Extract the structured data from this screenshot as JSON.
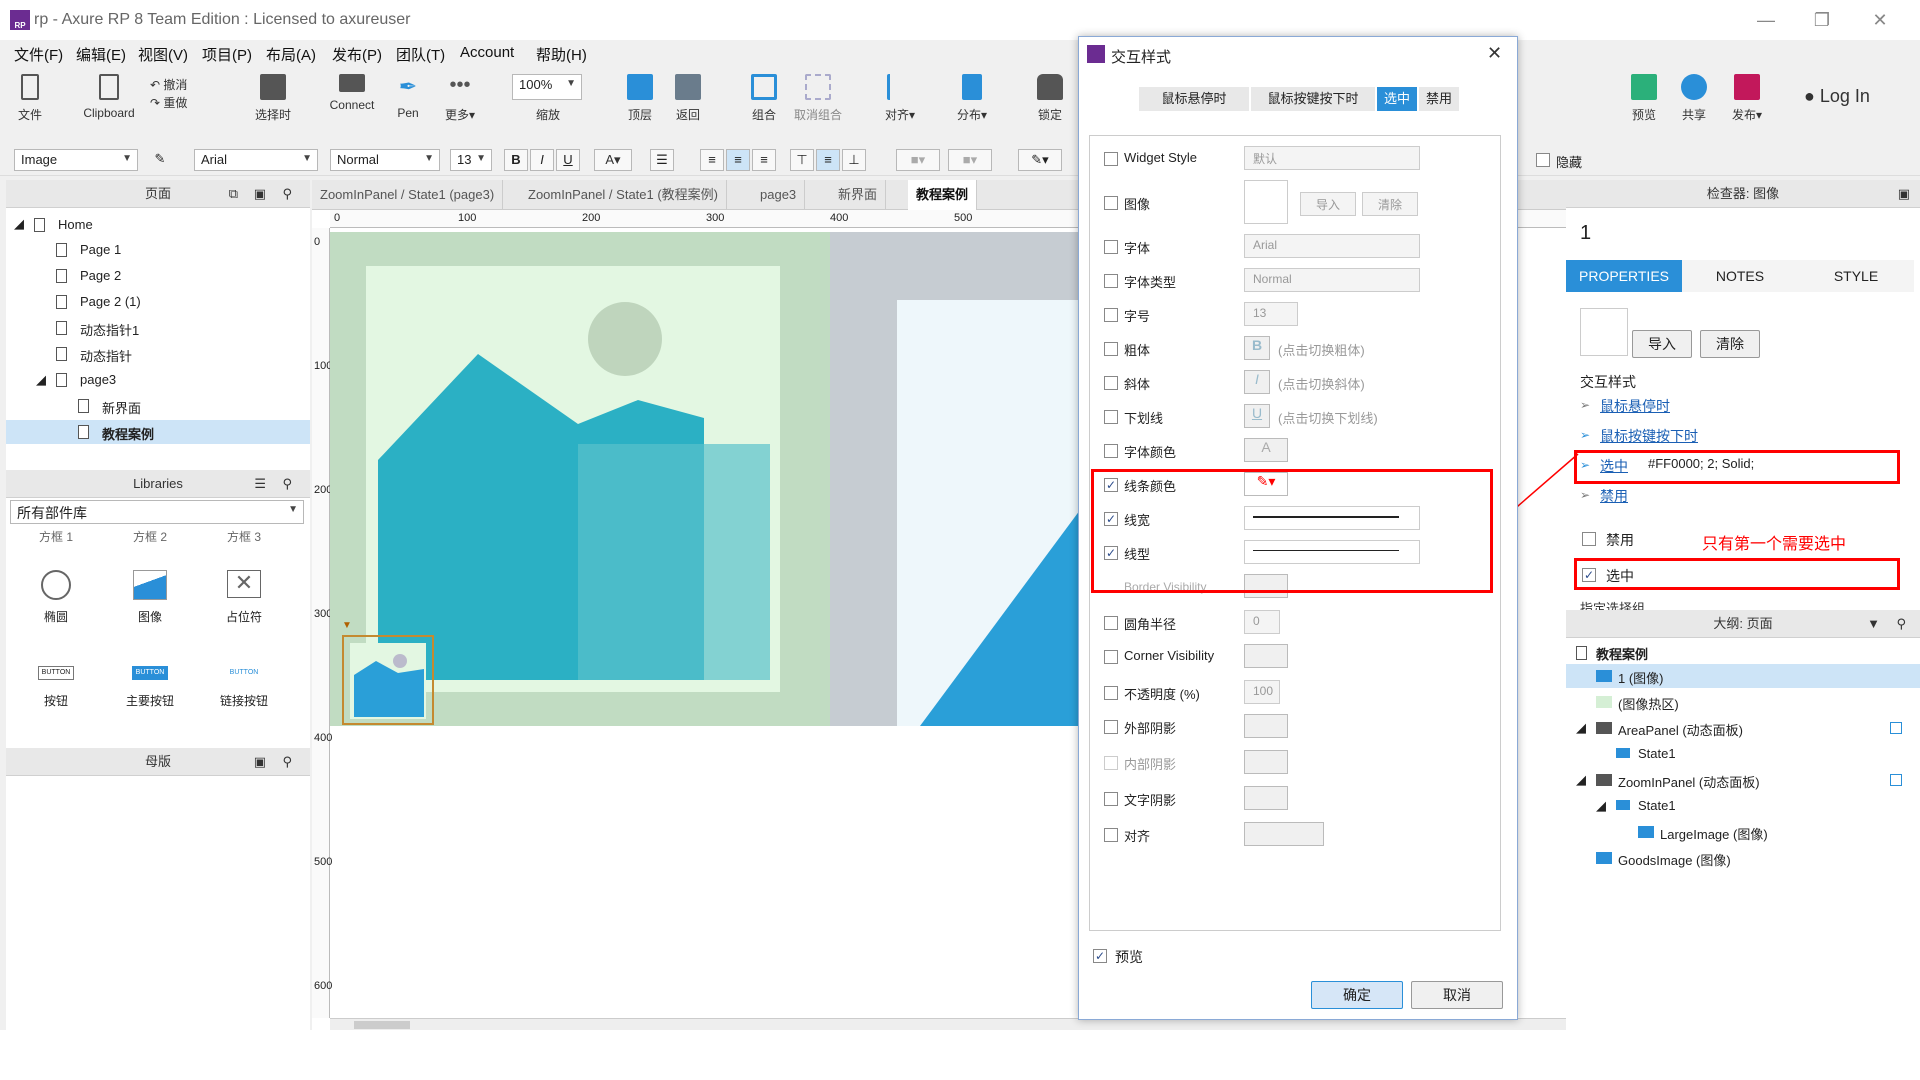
{
  "window": {
    "title": "rp - Axure RP 8 Team Edition : Licensed to axureuser",
    "logo_text": "RP"
  },
  "menu": [
    "文件(F)",
    "编辑(E)",
    "视图(V)",
    "项目(P)",
    "布局(A)",
    "发布(P)",
    "团队(T)",
    "Account",
    "帮助(H)"
  ],
  "toolbar": {
    "file": "文件",
    "clipboard": "Clipboard",
    "undo": "撤消",
    "redo": "重做",
    "select": "选择时",
    "connect": "Connect",
    "pen": "Pen",
    "more": "更多▾",
    "zoom_value": "100%",
    "zoom": "缩放",
    "top": "顶层",
    "back": "返回",
    "group": "组合",
    "ungroup": "取消组合",
    "align": "对齐▾",
    "distribute": "分布▾",
    "lock": "锁定",
    "preview": "预览",
    "share": "共享",
    "publish": "发布▾",
    "login": "Log In"
  },
  "format_bar": {
    "widget_type": "Image",
    "font": "Arial",
    "style": "Normal",
    "size": "13",
    "bold": "B",
    "italic": "I",
    "underline": "U",
    "hide_label": "隐藏"
  },
  "pages_panel": {
    "title": "页面",
    "items": [
      "Home",
      "Page 1",
      "Page 2",
      "Page 2 (1)",
      "动态指针1",
      "动态指针",
      "page3",
      "新界面",
      "教程案例"
    ]
  },
  "libraries_panel": {
    "title": "Libraries",
    "selected": "所有部件库",
    "top_labels": [
      "方框 1",
      "方框 2",
      "方框 3"
    ],
    "widgets": [
      "椭圆",
      "图像",
      "占位符",
      "按钮",
      "主要按钮",
      "链接按钮"
    ],
    "button_texts": [
      "BUTTON",
      "BUTTON",
      "BUTTON"
    ]
  },
  "masters_panel": {
    "title": "母版"
  },
  "tabs": [
    "ZoomInPanel / State1 (page3)",
    "ZoomInPanel / State1 (教程案例)",
    "page3",
    "新界面",
    "教程案例"
  ],
  "ruler": {
    "h": [
      "0",
      "100",
      "200",
      "300",
      "400",
      "500"
    ],
    "v": [
      "0",
      "100",
      "200",
      "300",
      "400",
      "500",
      "600"
    ]
  },
  "dialog": {
    "title": "交互样式",
    "tabs": [
      "鼠标悬停时",
      "鼠标按键按下时",
      "选中",
      "禁用"
    ],
    "active_tab": "选中",
    "rows": [
      {
        "label": "Widget Style",
        "checked": false,
        "value": "默认"
      },
      {
        "label": "图像",
        "checked": false,
        "import": "导入",
        "clear": "清除"
      },
      {
        "label": "字体",
        "checked": false,
        "value": "Arial"
      },
      {
        "label": "字体类型",
        "checked": false,
        "value": "Normal"
      },
      {
        "label": "字号",
        "checked": false,
        "value": "13"
      },
      {
        "label": "粗体",
        "checked": false,
        "hint": "(点击切换粗体)"
      },
      {
        "label": "斜体",
        "checked": false,
        "hint": "(点击切换斜体)"
      },
      {
        "label": "下划线",
        "checked": false,
        "hint": "(点击切换下划线)"
      },
      {
        "label": "字体颜色",
        "checked": false
      },
      {
        "label": "线条颜色",
        "checked": true
      },
      {
        "label": "线宽",
        "checked": true
      },
      {
        "label": "线型",
        "checked": true
      },
      {
        "label": "Border Visibility",
        "checked": false
      },
      {
        "label": "圆角半径",
        "checked": false,
        "value": "0"
      },
      {
        "label": "Corner Visibility",
        "checked": false
      },
      {
        "label": "不透明度 (%)",
        "checked": false,
        "value": "100"
      },
      {
        "label": "外部阴影",
        "checked": false
      },
      {
        "label": "内部阴影",
        "checked": false
      },
      {
        "label": "文字阴影",
        "checked": false
      },
      {
        "label": "对齐",
        "checked": false
      }
    ],
    "preview_label": "预览",
    "ok": "确定",
    "cancel": "取消"
  },
  "inspector": {
    "title": "检查器: 图像",
    "name": "1",
    "tabs": [
      "PROPERTIES",
      "NOTES",
      "STYLE"
    ],
    "import": "导入",
    "clear": "清除",
    "section": "交互样式",
    "links": [
      "鼠标悬停时",
      "鼠标按键按下时",
      "选中",
      "禁用"
    ],
    "selected_value": "#FF0000; 2; Solid;",
    "disabled_label": "禁用",
    "selected_label": "选中",
    "annotation": "只有第一个需要选中",
    "partial_text": "指定选择组"
  },
  "outline": {
    "title": "大纲: 页面",
    "items": [
      "教程案例",
      "1 (图像)",
      "(图像热区)",
      "AreaPanel (动态面板)",
      "State1",
      "ZoomInPanel (动态面板)",
      "State1",
      "LargeImage (图像)",
      "GoodsImage (图像)"
    ]
  },
  "colors": {
    "accent": "#2a8fd8",
    "red": "#ff0000",
    "teal": "#2bb0c4"
  }
}
